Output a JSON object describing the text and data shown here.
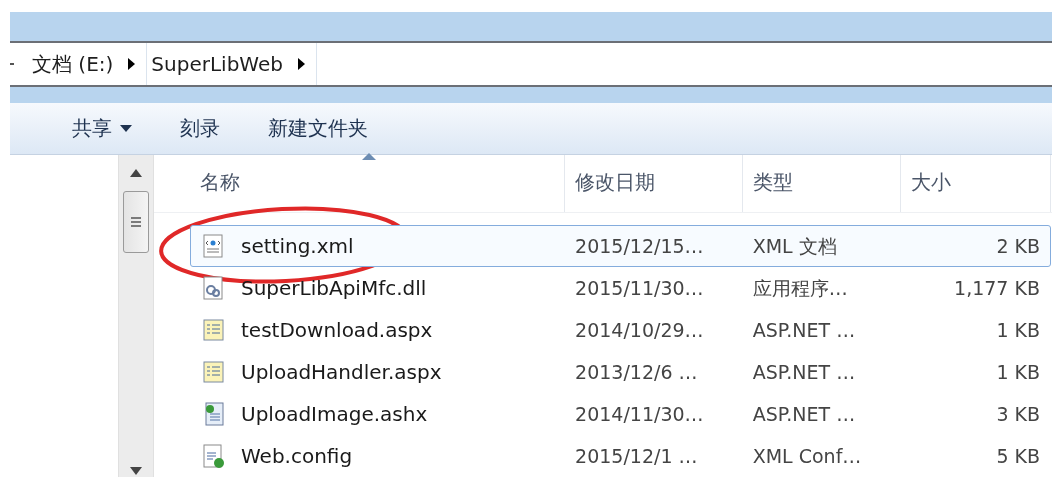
{
  "address_bar": {
    "crumbs": [
      {
        "label": "文档 (E:)"
      },
      {
        "label": "SuperLibWeb"
      }
    ]
  },
  "toolbar": [
    {
      "label": "共享",
      "dropdown": true
    },
    {
      "label": "刻录",
      "dropdown": false
    },
    {
      "label": "新建文件夹",
      "dropdown": false
    }
  ],
  "file_list": {
    "columns": [
      {
        "label": "名称",
        "sorted": true
      },
      {
        "label": "修改日期",
        "sorted": false
      },
      {
        "label": "类型",
        "sorted": false
      },
      {
        "label": "大小",
        "sorted": false
      }
    ],
    "rows": [
      {
        "kind": "xml",
        "name": "setting.xml",
        "date": "2015/12/15…",
        "type": "XML 文档",
        "size": "2 KB",
        "selected": true,
        "circled": true
      },
      {
        "kind": "dll",
        "name": "SuperLibApiMfc.dll",
        "date": "2015/11/30…",
        "type": "应用程序…",
        "size": "1,177 KB",
        "selected": false,
        "circled": false
      },
      {
        "kind": "aspx",
        "name": "testDownload.aspx",
        "date": "2014/10/29…",
        "type": "ASP.NET …",
        "size": "1 KB",
        "selected": false,
        "circled": false
      },
      {
        "kind": "aspx",
        "name": "UploadHandler.aspx",
        "date": "2013/12/6 …",
        "type": "ASP.NET …",
        "size": "1 KB",
        "selected": false,
        "circled": false
      },
      {
        "kind": "ashx",
        "name": "UploadImage.ashx",
        "date": "2014/11/30…",
        "type": "ASP.NET …",
        "size": "3 KB",
        "selected": false,
        "circled": false
      },
      {
        "kind": "config",
        "name": "Web.config",
        "date": "2015/12/1 …",
        "type": "XML Conf…",
        "size": "5 KB",
        "selected": false,
        "circled": false
      }
    ]
  }
}
